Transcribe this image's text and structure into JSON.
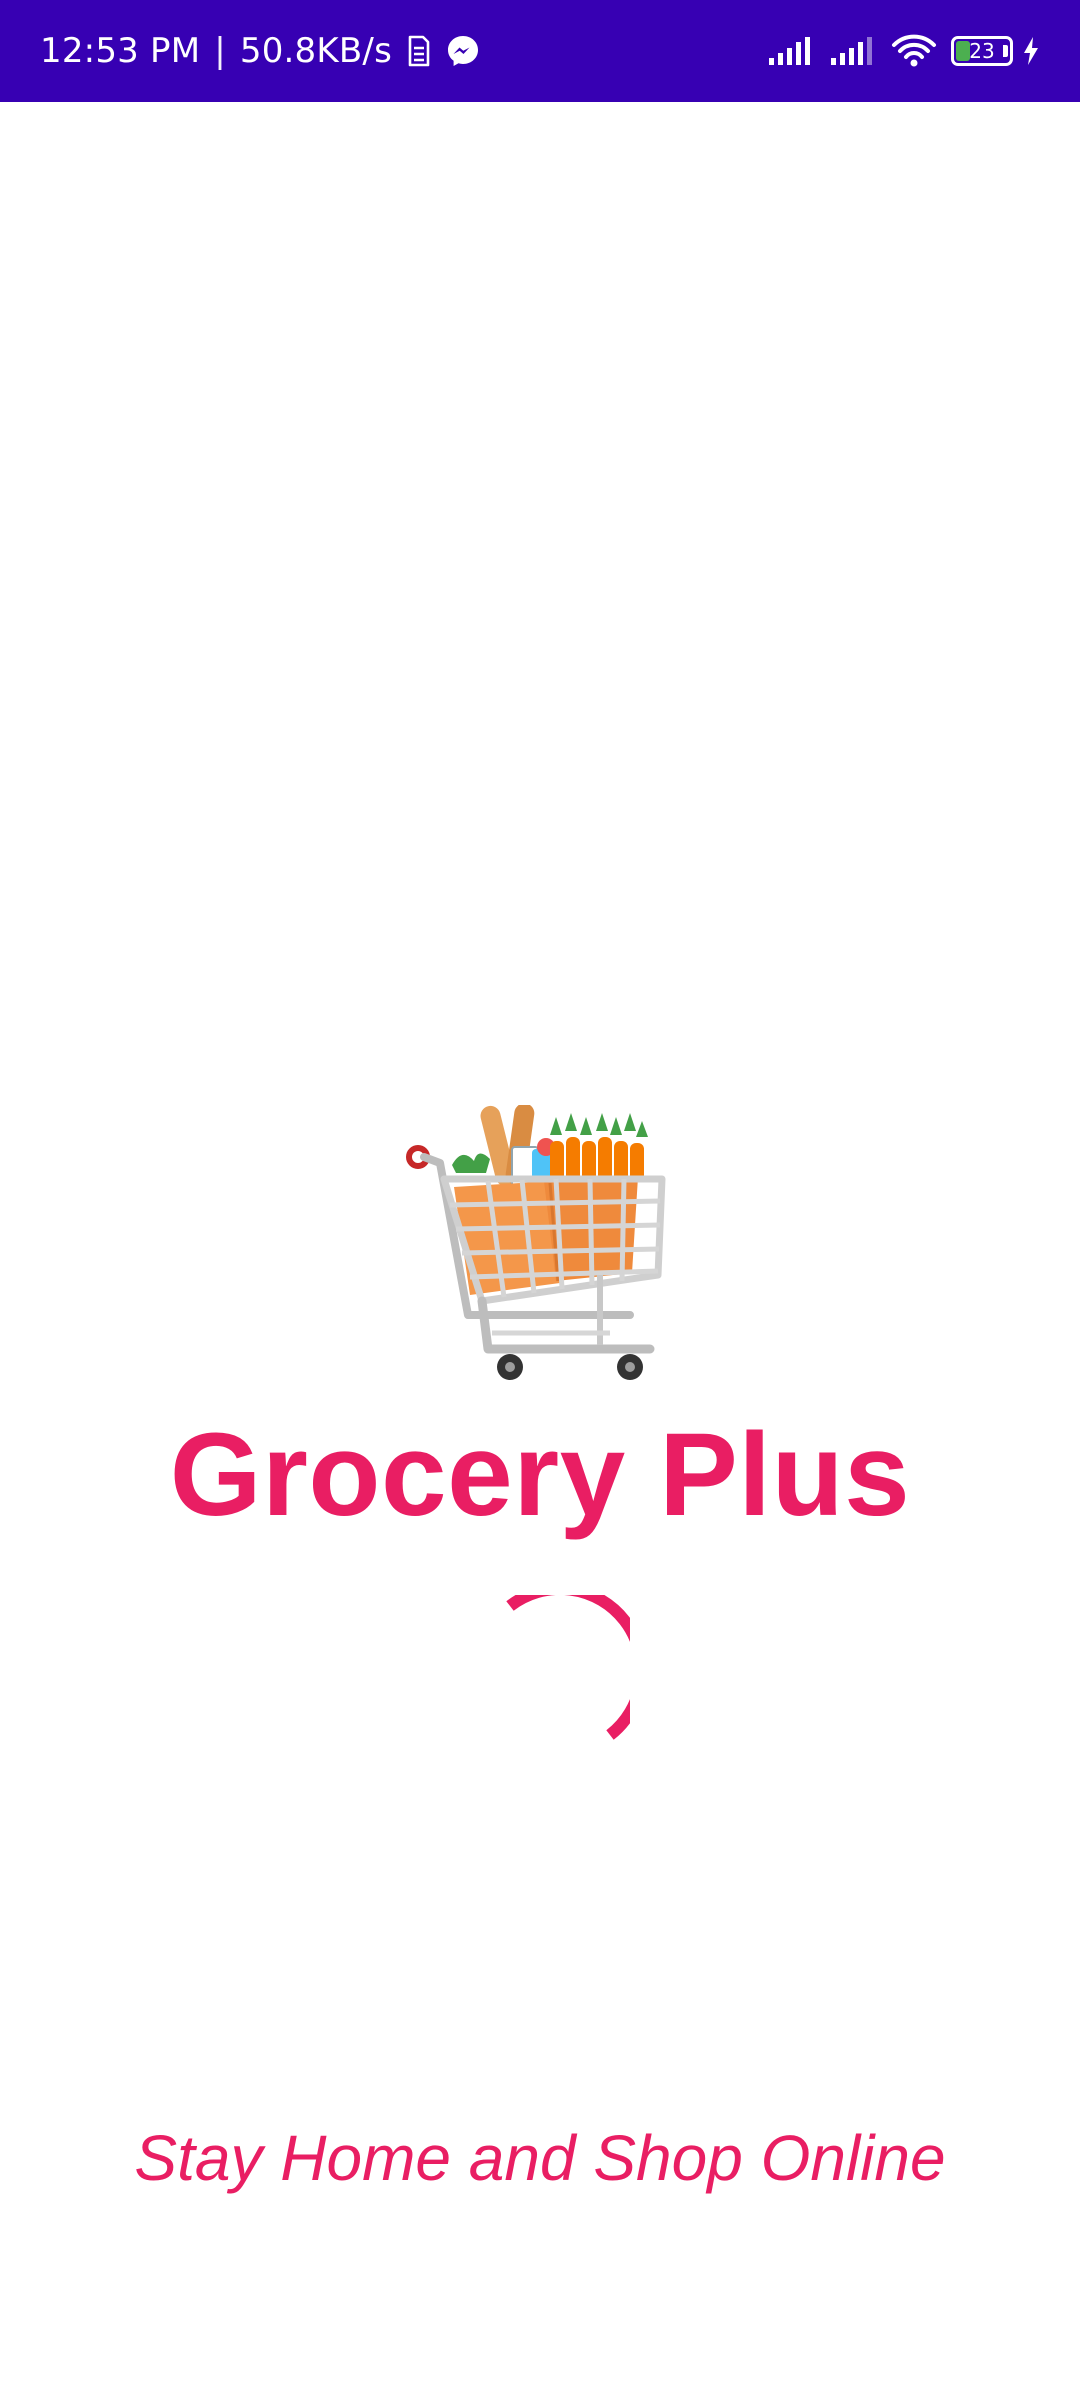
{
  "status_bar": {
    "time": "12:53 PM",
    "separator": "|",
    "network_speed": "50.8KB/s",
    "battery_level": "23",
    "icons": [
      "sim-icon",
      "messenger-icon",
      "signal-1-icon",
      "signal-2-icon",
      "wifi-icon",
      "battery-icon",
      "charging-icon"
    ],
    "background_color": "#3700b3"
  },
  "splash": {
    "logo_icon": "shopping-cart-with-groceries",
    "title": "Grocery Plus",
    "tagline": "Stay Home and Shop Online",
    "loading_indicator": "circular-progress-spinner",
    "accent_color": "#e91e63",
    "background_color": "#ffffff"
  }
}
